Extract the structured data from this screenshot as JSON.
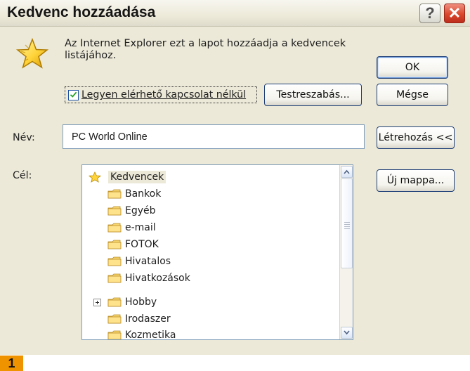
{
  "window": {
    "title": "Kedvenc hozzáadása",
    "help_button": "?",
    "close_button": "✕"
  },
  "dialog": {
    "info_line_1": "Az Internet Explorer ezt a lapot hozzáadja a kedvencek",
    "info_line_2": "listájához.",
    "checkbox_label": "Legyen elérhető kapcsolat nélkül",
    "checkbox_checked": true,
    "custom_button_label": "Testreszabás...",
    "ok_button_label": "OK",
    "cancel_button_label": "Mégse"
  },
  "name_field": {
    "label": "Név:",
    "value": "PC World Online"
  },
  "target": {
    "label": "Cél:",
    "create_button_label": "Létrehozás <<",
    "new_folder_button_label": "Új mappa..."
  },
  "folder_tree": {
    "root": "Kedvencek",
    "items": [
      "Bankok",
      "Egyéb",
      "e-mail",
      "FOTOK",
      "Hivatalos",
      "Hivatkozások",
      "Hobby",
      "Irodaszer",
      "Kozmetika"
    ]
  },
  "footer": {
    "number": "1"
  },
  "colors": {
    "dialog_background": "#ece9d8",
    "border_blue": "#7f9db9",
    "footer_orange": "#ef9300"
  },
  "icons": {
    "dialog_icon": "star-icon",
    "folder_icon": "folder-icon",
    "help_icon": "help-icon",
    "close_icon": "close-icon"
  }
}
